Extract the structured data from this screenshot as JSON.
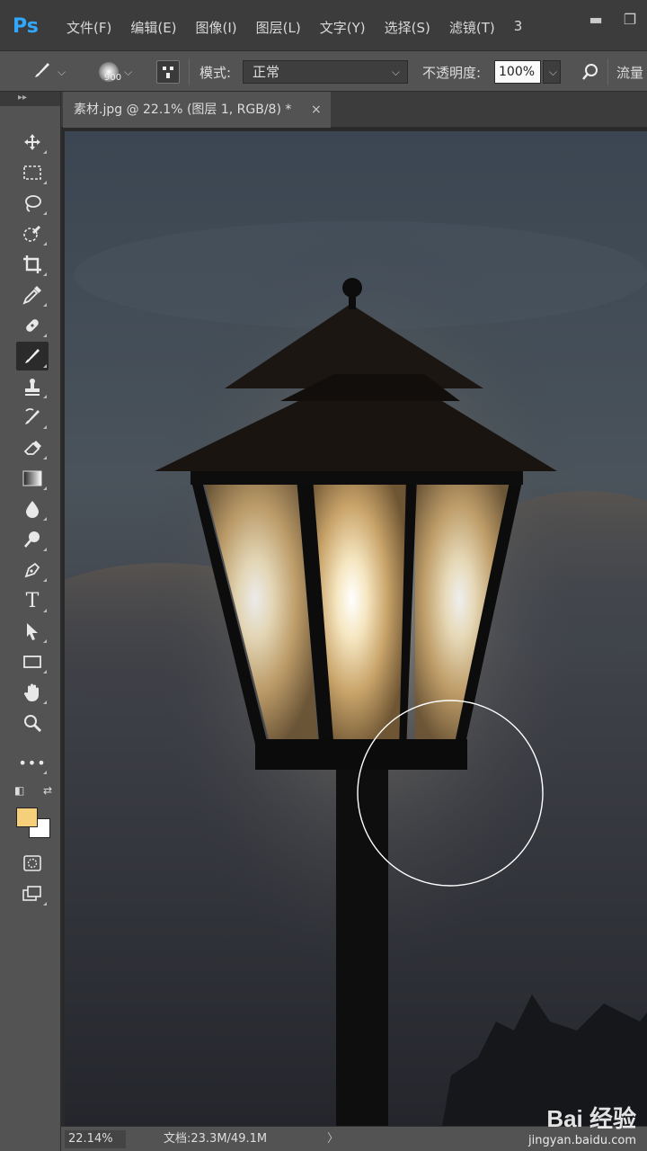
{
  "app": {
    "logo": "Ps"
  },
  "menu": {
    "items": [
      "文件(F)",
      "编辑(E)",
      "图像(I)",
      "图层(L)",
      "文字(Y)",
      "选择(S)",
      "滤镜(T)",
      "3"
    ]
  },
  "window_controls": {
    "minimize": "▬",
    "restore": "❐"
  },
  "options": {
    "brush_size": "900",
    "mode_label": "模式:",
    "mode_value": "正常",
    "opacity_label": "不透明度:",
    "opacity_value": "100%",
    "flow_label": "流量"
  },
  "document": {
    "tab_title": "素材.jpg @ 22.1% (图层 1, RGB/8) *",
    "close": "×"
  },
  "tools": [
    "move-icon",
    "marquee-icon",
    "lasso-icon",
    "quick-select-icon",
    "crop-icon",
    "eyedropper-icon",
    "healing-brush-icon",
    "brush-icon",
    "clone-stamp-icon",
    "history-brush-icon",
    "eraser-icon",
    "gradient-icon",
    "blur-icon",
    "dodge-icon",
    "pen-icon",
    "type-icon",
    "path-select-icon",
    "rectangle-icon",
    "hand-icon",
    "zoom-icon",
    "more-icon"
  ],
  "colors": {
    "foreground": "#f5cf7a",
    "background": "#ffffff",
    "ps_blue": "#31a8ff"
  },
  "status": {
    "zoom": "22.14%",
    "doc_info": "文档:23.3M/49.1M",
    "arrow": "〉"
  },
  "watermark": {
    "logo": "Bai 经验",
    "url": "jingyan.baidu.com"
  }
}
